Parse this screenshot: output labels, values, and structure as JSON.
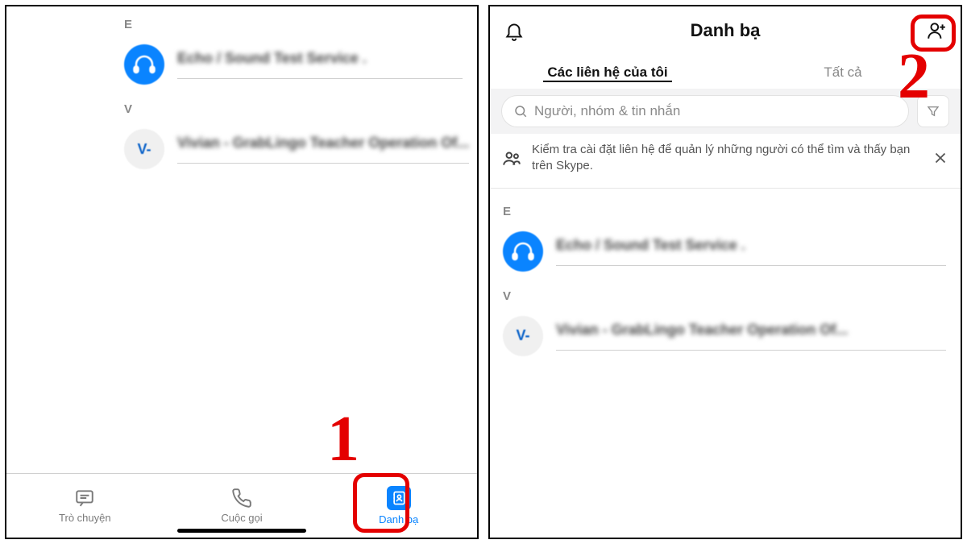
{
  "left": {
    "sections": {
      "e_letter": "E",
      "e_contact": "Echo / Sound Test Service .",
      "e_initial": "",
      "v_letter": "V",
      "v_contact": "Vivian - GrabLingo Teacher Operation Of...",
      "v_initial": "V-"
    },
    "tabs": {
      "chat": "Trò chuyện",
      "calls": "Cuộc gọi",
      "contacts": "Danh bạ"
    }
  },
  "right": {
    "title": "Danh bạ",
    "tabs": {
      "my_contacts": "Các liên hệ của tôi",
      "all": "Tất cả"
    },
    "search_placeholder": "Người, nhóm & tin nhắn",
    "banner": "Kiểm tra cài đặt liên hệ để quản lý những người có thể tìm và thấy bạn trên Skype.",
    "sections": {
      "e_letter": "E",
      "e_contact": "Echo / Sound Test Service .",
      "v_letter": "V",
      "v_contact": "Vivian - GrabLingo Teacher Operation Of...",
      "v_initial": "V-"
    }
  },
  "annotations": {
    "one": "1",
    "two": "2"
  }
}
